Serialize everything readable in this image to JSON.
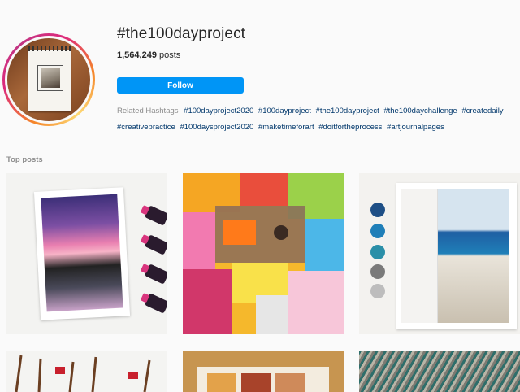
{
  "header": {
    "hashtag": "#the100dayproject",
    "post_count": "1,564,249",
    "post_count_suffix": "posts",
    "follow_label": "Follow"
  },
  "related": {
    "label": "Related Hashtags",
    "tags": [
      "#100dayproject2020",
      "#100dayproject",
      "#the100dayproject",
      "#the100daychallenge",
      "#createdaily",
      "#creativepractice",
      "#100daysproject2020",
      "#maketimeforart",
      "#doitfortheprocess",
      "#artjournalpages"
    ]
  },
  "section": {
    "top_posts": "Top posts"
  },
  "colors": {
    "accent": "#0095f6",
    "tag_link": "#00376b",
    "muted": "#8e8e8e"
  }
}
